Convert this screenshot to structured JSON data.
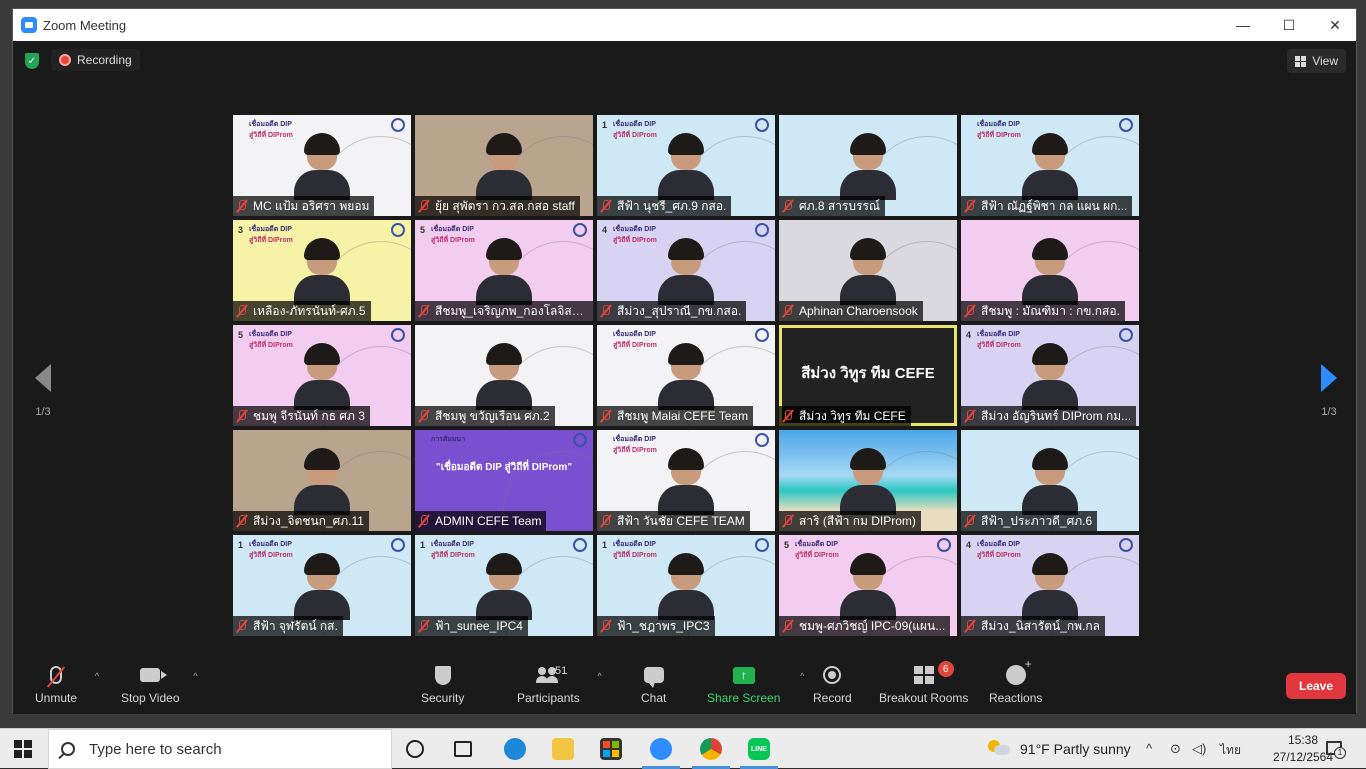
{
  "window": {
    "title": "Zoom Meeting",
    "controls": {
      "minimize": "—",
      "maximize": "☐",
      "close": "✕"
    }
  },
  "topbar": {
    "recording_label": "Recording",
    "view_label": "View"
  },
  "pager": {
    "left_label": "1/3",
    "right_label": "1/3"
  },
  "tiles": [
    {
      "name": "MC แป้ม อริศรา พยอม",
      "badge": "",
      "banner": [
        "เชื่อมอดีต DIP",
        "สู่วิถีที่ DIProm"
      ]
    },
    {
      "name": "ยุ้ย สุพัตรา กว.สล.กสอ staff",
      "badge": "",
      "banner": []
    },
    {
      "name": "สีฟ้า นุชรี_ศภ.9 กสอ.",
      "badge": "1",
      "banner": [
        "เชื่อมอดีต DIP",
        "สู่วิถีที่ DIProm"
      ]
    },
    {
      "name": "ศภ.8 สารบรรณ์",
      "badge": "",
      "banner": []
    },
    {
      "name": "สีฟ้า ณัฏฐ์พิชา กล แผน ผก...",
      "badge": "",
      "banner": [
        "เชื่อมอดีต DIP",
        "สู่วิถีที่ DIProm"
      ]
    },
    {
      "name": "เหลือง-ภัทรนันท์-ศภ.5",
      "badge": "3",
      "banner": [
        "เชื่อมอดีต DIP",
        "สู่วิถีที่ DIProm"
      ]
    },
    {
      "name": "สีชมพู_เจริญภพ_กองโลจิสติกส์",
      "badge": "5",
      "banner": [
        "เชื่อมอดีต DIP",
        "สู่วิถีที่ DIProm"
      ]
    },
    {
      "name": "สีม่วง_สุปราณี_กข.กสอ.",
      "badge": "4",
      "banner": [
        "เชื่อมอดีต DIP",
        "สู่วิถีที่ DIProm"
      ]
    },
    {
      "name": "Aphinan Charoensook",
      "badge": "",
      "banner": []
    },
    {
      "name": "สีชมพู : มัณฑิมา : กข.กสอ.",
      "badge": "",
      "banner": []
    },
    {
      "name": "ชมพู จีรนันท์ กธ ศภ 3",
      "badge": "5",
      "banner": [
        "เชื่อมอดีต DIP",
        "สู่วิถีที่ DIProm"
      ]
    },
    {
      "name": "สีชมพู ขวัญเรือน ศภ.2",
      "badge": "",
      "banner": []
    },
    {
      "name": "สีชมพู Malai CEFE Team",
      "badge": "",
      "banner": [
        "เชื่อมอดีต DIP",
        "สู่วิถีที่ DIProm"
      ]
    },
    {
      "name": "สีม่วง วิทูร ทีม CEFE",
      "badge": "",
      "banner": [],
      "big_name": "สีม่วง วิทูร ทีม CEFE",
      "active": true
    },
    {
      "name": "สีม่วง อัญรินทร์ DIProm กม...",
      "badge": "4",
      "banner": [
        "เชื่อมอดีต DIP",
        "สู่วิถีที่ DIProm"
      ]
    },
    {
      "name": "สีม่วง_จิตชนก_ศภ.11",
      "badge": "",
      "banner": []
    },
    {
      "name": "ADMIN CEFE Team",
      "badge": "",
      "banner": [
        "การสัมมนา",
        ""
      ],
      "banner_text": "\"เชื่อมอดีต DIP สู่วิถีที่ DIProm\""
    },
    {
      "name": "สีฟ้า วันชัย CEFE TEAM",
      "badge": "",
      "banner": [
        "เชื่อมอดีต DIP",
        "สู่วิถีที่ DIProm"
      ]
    },
    {
      "name": "สาริ (สีฟ้า กม DIProm)",
      "badge": "",
      "banner": []
    },
    {
      "name": "สีฟ้า_ประภาวดี_ศภ.6",
      "badge": "",
      "banner": []
    },
    {
      "name": "สีฟ้า จุฬรัตน์ กส.",
      "badge": "1",
      "banner": [
        "เชื่อมอดีต DIP",
        "สู่วิถีที่ DIProm"
      ]
    },
    {
      "name": "ฟ้า_sunee_IPC4",
      "badge": "1",
      "banner": [
        "เชื่อมอดีต DIP",
        "สู่วิถีที่ DIProm"
      ]
    },
    {
      "name": "ฟ้า_ชฎาพร_IPC3",
      "badge": "1",
      "banner": [
        "เชื่อมอดีต DIP",
        "สู่วิถีที่ DIProm"
      ]
    },
    {
      "name": "ชมพู-ศภวิชญ์ IPC-09(แผน...",
      "badge": "5",
      "banner": [
        "เชื่อมอดีต DIP",
        "สู่วิถีที่ DIProm"
      ]
    },
    {
      "name": "สีม่วง_นิสารัตน์_กพ.กล",
      "badge": "4",
      "banner": [
        "เชื่อมอดีต DIP",
        "สู่วิถีที่ DIProm"
      ]
    }
  ],
  "toolbar": {
    "unmute": "Unmute",
    "stop_video": "Stop Video",
    "security": "Security",
    "participants": "Participants",
    "participants_count": "51",
    "chat": "Chat",
    "share_screen": "Share Screen",
    "share_glyph": "↑",
    "record": "Record",
    "breakout_rooms": "Breakout Rooms",
    "breakout_badge": "6",
    "reactions": "Reactions",
    "leave": "Leave",
    "caret": "^"
  },
  "taskbar": {
    "search_placeholder": "Type here to search",
    "line_label": "LINE",
    "weather": "91°F  Partly sunny",
    "tray_chevron": "^",
    "tray_lang": "ไทย",
    "time": "15:38",
    "date": "27/12/2564",
    "notification_count": "1"
  },
  "colors": {
    "accent": "#2d8cff",
    "leave": "#e0383e",
    "share": "#23b14d",
    "active_speaker": "#e9e46a"
  }
}
